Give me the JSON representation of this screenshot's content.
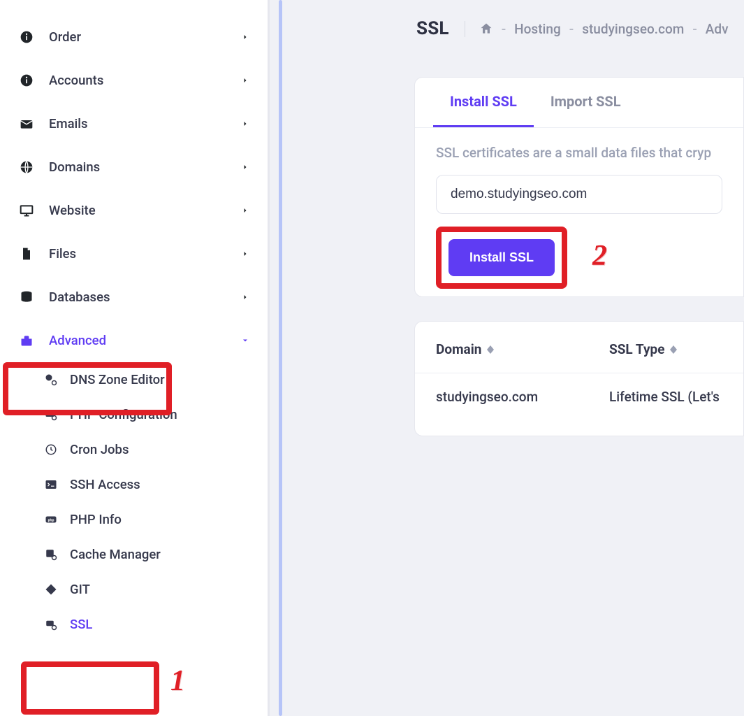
{
  "sidebar": {
    "items": [
      {
        "label": "Order",
        "icon": "info"
      },
      {
        "label": "Accounts",
        "icon": "info"
      },
      {
        "label": "Emails",
        "icon": "mail"
      },
      {
        "label": "Domains",
        "icon": "globe"
      },
      {
        "label": "Website",
        "icon": "monitor"
      },
      {
        "label": "Files",
        "icon": "file"
      },
      {
        "label": "Databases",
        "icon": "database"
      },
      {
        "label": "Advanced",
        "icon": "toolbox"
      }
    ],
    "advanced_sub": [
      {
        "label": "DNS Zone Editor",
        "icon": "dns"
      },
      {
        "label": "PHP Configuration",
        "icon": "php"
      },
      {
        "label": "Cron Jobs",
        "icon": "clock"
      },
      {
        "label": "SSH Access",
        "icon": "terminal"
      },
      {
        "label": "PHP Info",
        "icon": "phpinfo"
      },
      {
        "label": "Cache Manager",
        "icon": "cache"
      },
      {
        "label": "GIT",
        "icon": "git"
      },
      {
        "label": "SSL",
        "icon": "ssl"
      }
    ]
  },
  "page": {
    "title": "SSL",
    "breadcrumb": [
      "Hosting",
      "studyingseo.com",
      "Adv"
    ]
  },
  "tabs": {
    "install": "Install SSL",
    "import": "Import SSL"
  },
  "panel": {
    "desc": "SSL certificates are a small data files that cryp",
    "domain_value": "demo.studyingseo.com",
    "install_button": "Install SSL"
  },
  "table": {
    "head_domain": "Domain",
    "head_type": "SSL Type",
    "rows": [
      {
        "domain": "studyingseo.com",
        "type": "Lifetime SSL (Let's Enc"
      }
    ]
  },
  "callouts": {
    "one": "1",
    "two": "2"
  }
}
